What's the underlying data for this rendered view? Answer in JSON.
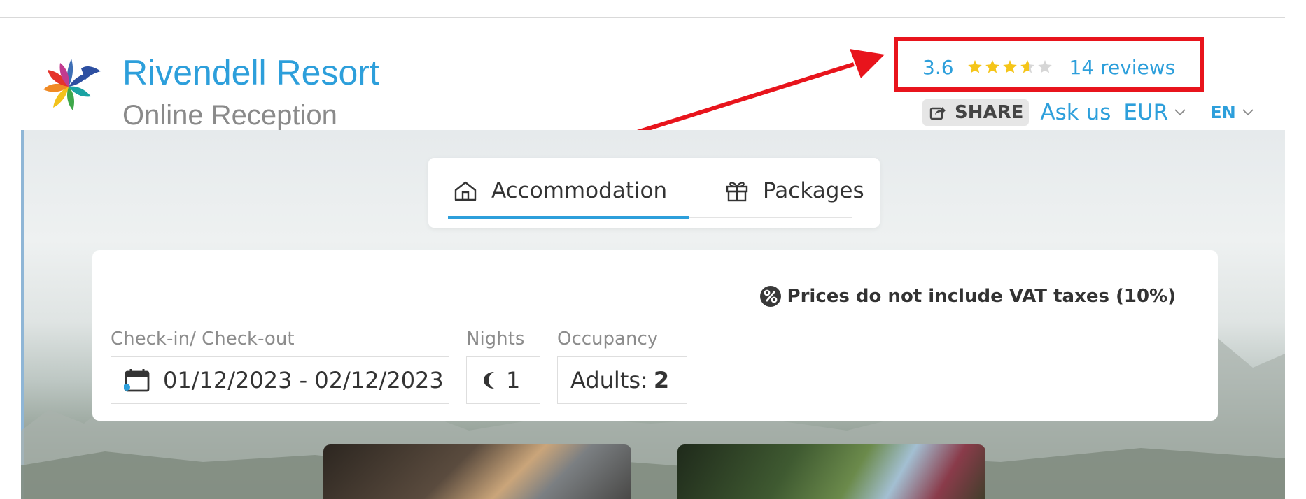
{
  "header": {
    "hotel_name": "Rivendell Resort",
    "subtitle": "Online Reception",
    "rating": {
      "score": "3.6",
      "stars_value": 3.6,
      "stars_max": 5,
      "reviews": "14 reviews"
    },
    "share_label": "SHARE",
    "ask_label": "Ask us",
    "currency": "EUR",
    "language": "EN"
  },
  "tabs": [
    {
      "label": "Accommodation",
      "active": true
    },
    {
      "label": "Packages",
      "active": false
    }
  ],
  "search": {
    "vat_notice": "Prices do not include VAT taxes (10%)",
    "checkin_label": "Check-in/ Check-out",
    "dates": "01/12/2023 - 02/12/2023",
    "nights_label": "Nights",
    "nights": "1",
    "occupancy_label": "Occupancy",
    "adults_label": "Adults:",
    "adults": "2"
  },
  "colors": {
    "accent": "#2d9fdb",
    "highlight": "#e8141c",
    "star": "#f5c518"
  }
}
